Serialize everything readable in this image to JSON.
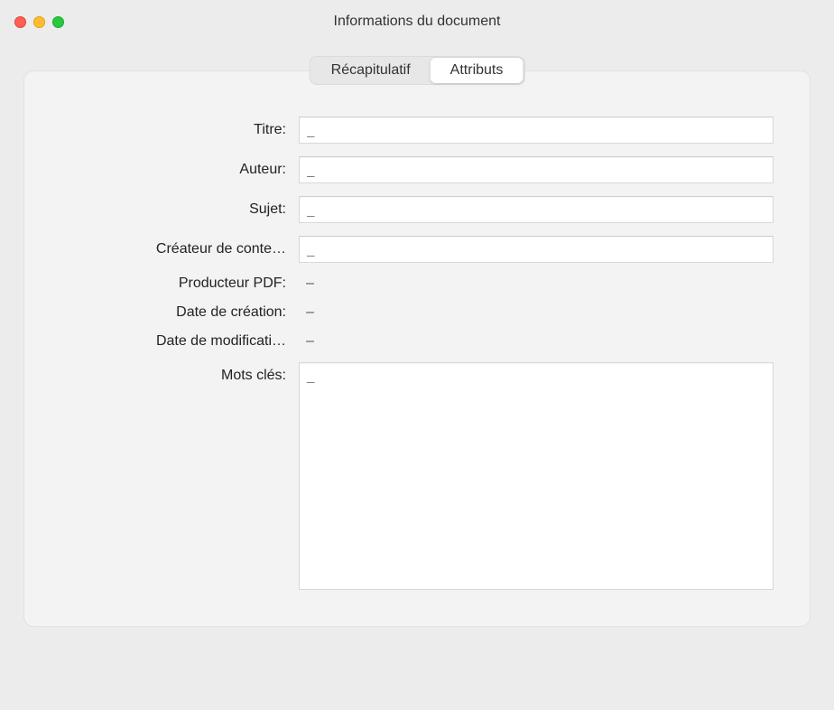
{
  "window": {
    "title": "Informations du document"
  },
  "tabs": {
    "summary": "Récapitulatif",
    "attributes": "Attributs"
  },
  "fields": {
    "title_label": "Titre:",
    "title_value": "_",
    "author_label": "Auteur:",
    "author_value": "_",
    "subject_label": "Sujet:",
    "subject_value": "_",
    "creator_label": "Créateur de conte…",
    "creator_value": "_",
    "producer_label": "Producteur PDF:",
    "producer_value": "–",
    "created_label": "Date de création:",
    "created_value": "–",
    "modified_label": "Date de modificati…",
    "modified_value": "–",
    "keywords_label": "Mots clés:",
    "keywords_value": "_"
  }
}
